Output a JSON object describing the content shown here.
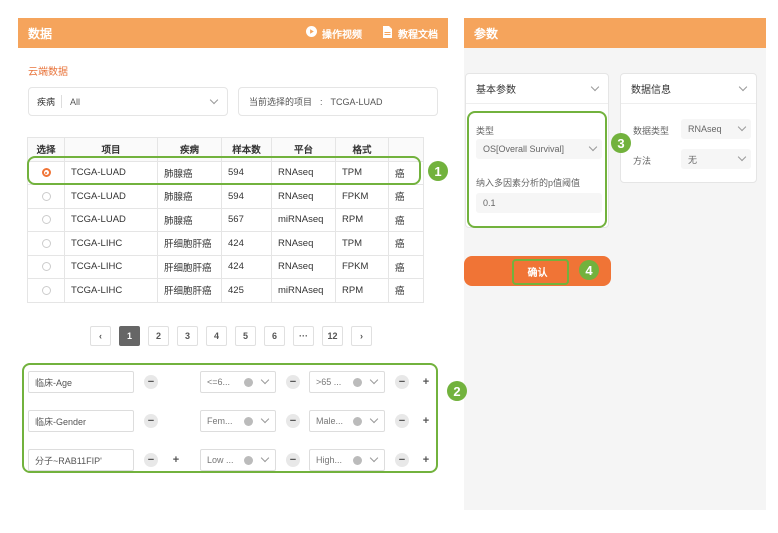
{
  "left": {
    "title": "数据",
    "video_link": "操作视频",
    "docs_link": "教程文档",
    "subtitle": "云端数据",
    "disease_filter": {
      "label": "疾病",
      "value": "All"
    },
    "current_project": {
      "label": "当前选择的项目",
      "sep": ":",
      "value": "TCGA-LUAD"
    }
  },
  "table": {
    "headers": [
      "选择",
      "项目",
      "疾病",
      "样本数",
      "平台",
      "格式",
      ""
    ],
    "rows": [
      {
        "project": "TCGA-LUAD",
        "disease": "肺腺癌",
        "samples": "594",
        "platform": "RNAseq",
        "format": "TPM",
        "extra": "癌"
      },
      {
        "project": "TCGA-LUAD",
        "disease": "肺腺癌",
        "samples": "594",
        "platform": "RNAseq",
        "format": "FPKM",
        "extra": "癌"
      },
      {
        "project": "TCGA-LUAD",
        "disease": "肺腺癌",
        "samples": "567",
        "platform": "miRNAseq",
        "format": "RPM",
        "extra": "癌"
      },
      {
        "project": "TCGA-LIHC",
        "disease": "肝细胞肝癌",
        "samples": "424",
        "platform": "RNAseq",
        "format": "TPM",
        "extra": "癌"
      },
      {
        "project": "TCGA-LIHC",
        "disease": "肝细胞肝癌",
        "samples": "424",
        "platform": "RNAseq",
        "format": "FPKM",
        "extra": "癌"
      },
      {
        "project": "TCGA-LIHC",
        "disease": "肝细胞肝癌",
        "samples": "425",
        "platform": "miRNAseq",
        "format": "RPM",
        "extra": "癌"
      }
    ]
  },
  "pagination": {
    "pages": [
      "1",
      "2",
      "3",
      "4",
      "5",
      "6",
      "···",
      "12"
    ],
    "active": "1"
  },
  "filters": [
    {
      "name": "临床-Age",
      "low": "<=6...",
      "high": ">65 ..."
    },
    {
      "name": "临床-Gender",
      "low": "Fem...",
      "high": "Male..."
    },
    {
      "name": "分子~RAB11FIP'",
      "low": "Low ...",
      "high": "High..."
    }
  ],
  "right": {
    "title": "参数",
    "basic": {
      "title": "基本参数",
      "type_label": "类型",
      "type_value": "OS[Overall Survival]",
      "p_label": "纳入多因素分析的p值阈值",
      "p_value": "0.1"
    },
    "data_info": {
      "title": "数据信息",
      "dtype_label": "数据类型",
      "dtype_value": "RNAseq",
      "method_label": "方法",
      "method_value": "无"
    },
    "confirm": "确认"
  },
  "badges": [
    "1",
    "2",
    "3",
    "4"
  ],
  "colors": {
    "header": "#f5a45c",
    "accent": "#f07436",
    "highlight": "#72b23d"
  }
}
